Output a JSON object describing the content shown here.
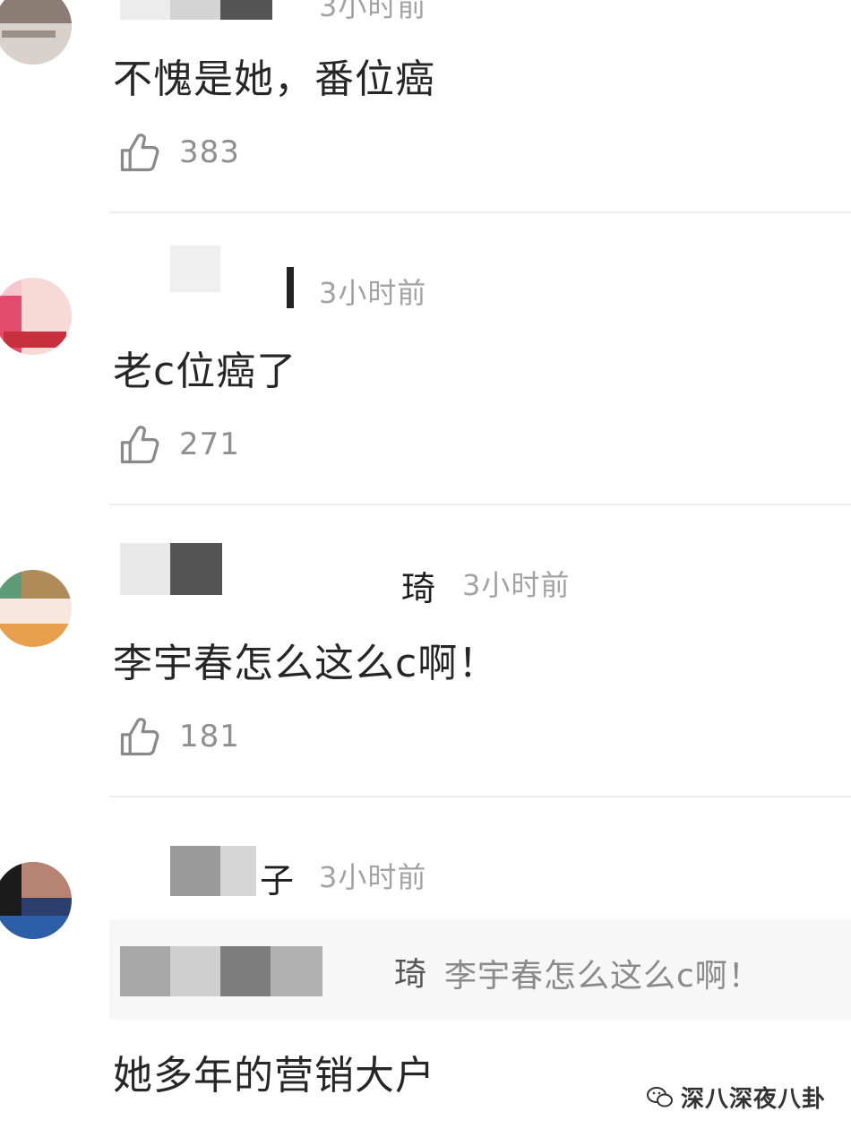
{
  "comments": [
    {
      "time": "3小时前",
      "content": "不愧是她，番位癌",
      "likes": "383"
    },
    {
      "time": "3小时前",
      "content": "老c位癌了",
      "likes": "271"
    },
    {
      "name_tail": "琦",
      "time": "3小时前",
      "content": "李宇春怎么这么c啊！",
      "likes": "181"
    },
    {
      "name_tail": "子",
      "time": "3小时前",
      "reply_to": {
        "name_tail": "琦",
        "text": "李宇春怎么这么c啊！"
      },
      "content": "她多年的营销大户"
    }
  ],
  "watermark": {
    "text": "深八深夜八卦",
    "icon": "wechat-icon"
  },
  "icons": {
    "like": "thumbs-up-icon"
  },
  "colors": {
    "time_text": "#a3a3a3",
    "like_count": "#8f8f8f",
    "divider": "#ececec",
    "quote_bg": "#f7f7f7"
  }
}
